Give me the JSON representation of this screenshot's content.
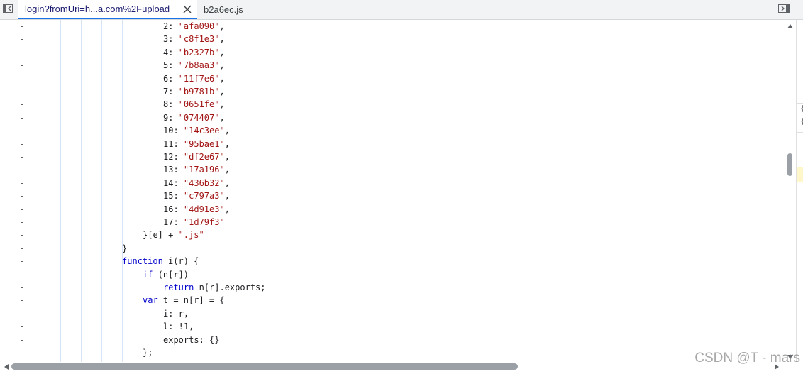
{
  "tabs": {
    "active_label": "login?fromUri=h...a.com%2Fupload",
    "inactive_label": "b2a6ec.js"
  },
  "icons": {
    "left_toggle": "sidebar-toggle-icon",
    "close": "close-icon",
    "right_toggle": "panel-toggle-icon"
  },
  "code": {
    "diff_marker": "-",
    "lines": [
      {
        "indent": 7,
        "parts": [
          [
            "num",
            "2"
          ],
          [
            "p",
            ": "
          ],
          [
            "str",
            "\"afa090\""
          ],
          [
            "p",
            ","
          ]
        ]
      },
      {
        "indent": 7,
        "parts": [
          [
            "num",
            "3"
          ],
          [
            "p",
            ": "
          ],
          [
            "str",
            "\"c8f1e3\""
          ],
          [
            "p",
            ","
          ]
        ]
      },
      {
        "indent": 7,
        "parts": [
          [
            "num",
            "4"
          ],
          [
            "p",
            ": "
          ],
          [
            "str",
            "\"b2327b\""
          ],
          [
            "p",
            ","
          ]
        ]
      },
      {
        "indent": 7,
        "parts": [
          [
            "num",
            "5"
          ],
          [
            "p",
            ": "
          ],
          [
            "str",
            "\"7b8aa3\""
          ],
          [
            "p",
            ","
          ]
        ]
      },
      {
        "indent": 7,
        "parts": [
          [
            "num",
            "6"
          ],
          [
            "p",
            ": "
          ],
          [
            "str",
            "\"11f7e6\""
          ],
          [
            "p",
            ","
          ]
        ]
      },
      {
        "indent": 7,
        "parts": [
          [
            "num",
            "7"
          ],
          [
            "p",
            ": "
          ],
          [
            "str",
            "\"b9781b\""
          ],
          [
            "p",
            ","
          ]
        ]
      },
      {
        "indent": 7,
        "parts": [
          [
            "num",
            "8"
          ],
          [
            "p",
            ": "
          ],
          [
            "str",
            "\"0651fe\""
          ],
          [
            "p",
            ","
          ]
        ]
      },
      {
        "indent": 7,
        "parts": [
          [
            "num",
            "9"
          ],
          [
            "p",
            ": "
          ],
          [
            "str",
            "\"074407\""
          ],
          [
            "p",
            ","
          ]
        ]
      },
      {
        "indent": 7,
        "parts": [
          [
            "num",
            "10"
          ],
          [
            "p",
            ": "
          ],
          [
            "str",
            "\"14c3ee\""
          ],
          [
            "p",
            ","
          ]
        ]
      },
      {
        "indent": 7,
        "parts": [
          [
            "num",
            "11"
          ],
          [
            "p",
            ": "
          ],
          [
            "str",
            "\"95bae1\""
          ],
          [
            "p",
            ","
          ]
        ]
      },
      {
        "indent": 7,
        "parts": [
          [
            "num",
            "12"
          ],
          [
            "p",
            ": "
          ],
          [
            "str",
            "\"df2e67\""
          ],
          [
            "p",
            ","
          ]
        ]
      },
      {
        "indent": 7,
        "parts": [
          [
            "num",
            "13"
          ],
          [
            "p",
            ": "
          ],
          [
            "str",
            "\"17a196\""
          ],
          [
            "p",
            ","
          ]
        ]
      },
      {
        "indent": 7,
        "parts": [
          [
            "num",
            "14"
          ],
          [
            "p",
            ": "
          ],
          [
            "str",
            "\"436b32\""
          ],
          [
            "p",
            ","
          ]
        ]
      },
      {
        "indent": 7,
        "parts": [
          [
            "num",
            "15"
          ],
          [
            "p",
            ": "
          ],
          [
            "str",
            "\"c797a3\""
          ],
          [
            "p",
            ","
          ]
        ]
      },
      {
        "indent": 7,
        "parts": [
          [
            "num",
            "16"
          ],
          [
            "p",
            ": "
          ],
          [
            "str",
            "\"4d91e3\""
          ],
          [
            "p",
            ","
          ]
        ]
      },
      {
        "indent": 7,
        "parts": [
          [
            "num",
            "17"
          ],
          [
            "p",
            ": "
          ],
          [
            "str",
            "\"1d79f3\""
          ]
        ]
      },
      {
        "indent": 6,
        "parts": [
          [
            "p",
            "}[e] + "
          ],
          [
            "str",
            "\".js\""
          ]
        ]
      },
      {
        "indent": 5,
        "parts": [
          [
            "p",
            "}"
          ]
        ]
      },
      {
        "indent": 5,
        "parts": [
          [
            "kw",
            "function"
          ],
          [
            "p",
            " i(r) {"
          ]
        ]
      },
      {
        "indent": 6,
        "parts": [
          [
            "kw",
            "if"
          ],
          [
            "p",
            " (n[r])"
          ]
        ]
      },
      {
        "indent": 7,
        "parts": [
          [
            "kw",
            "return"
          ],
          [
            "p",
            " n[r].exports;"
          ]
        ]
      },
      {
        "indent": 6,
        "parts": [
          [
            "kw",
            "var"
          ],
          [
            "p",
            " t = n[r] = {"
          ]
        ]
      },
      {
        "indent": 7,
        "parts": [
          [
            "p",
            "i: r,"
          ]
        ]
      },
      {
        "indent": 7,
        "parts": [
          [
            "p",
            "l: !1,"
          ]
        ]
      },
      {
        "indent": 7,
        "parts": [
          [
            "p",
            "exports: {}"
          ]
        ]
      },
      {
        "indent": 6,
        "parts": [
          [
            "p",
            "};"
          ]
        ]
      }
    ]
  },
  "side_panel": {
    "marks": [
      "{",
      "{"
    ]
  },
  "watermark": "CSDN @T - mars",
  "colors": {
    "string": "#a31515",
    "keyword": "#0000cc",
    "accent": "#1a73e8"
  }
}
